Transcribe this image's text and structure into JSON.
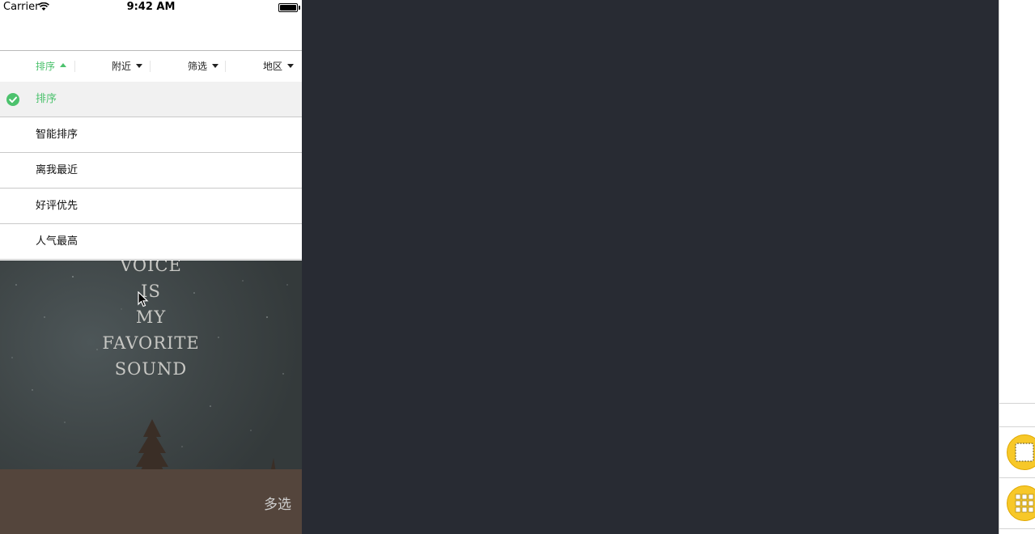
{
  "status_bar": {
    "carrier": "Carrier",
    "time": "9:42 AM"
  },
  "filter_tabs": [
    {
      "label": "排序",
      "active": true
    },
    {
      "label": "附近",
      "active": false
    },
    {
      "label": "筛选",
      "active": false
    },
    {
      "label": "地区",
      "active": false
    }
  ],
  "dropdown": {
    "items": [
      {
        "label": "排序",
        "selected": true
      },
      {
        "label": "智能排序",
        "selected": false
      },
      {
        "label": "离我最近",
        "selected": false
      },
      {
        "label": "好评优先",
        "selected": false
      },
      {
        "label": "人气最高",
        "selected": false
      }
    ]
  },
  "background": {
    "text_lines": [
      "VOICE",
      "IS",
      "MY",
      "FAVORITE",
      "SOUND"
    ],
    "multi_select_label": "多选"
  },
  "colors": {
    "accent": "#4cc26d",
    "editor_bg": "#282b33",
    "object_icon": "#f7c829"
  },
  "icons": [
    "wifi-icon",
    "battery-icon",
    "check-icon",
    "caret-up-icon",
    "caret-down-icon",
    "cursor-icon",
    "view-object-icon",
    "collection-view-icon"
  ]
}
